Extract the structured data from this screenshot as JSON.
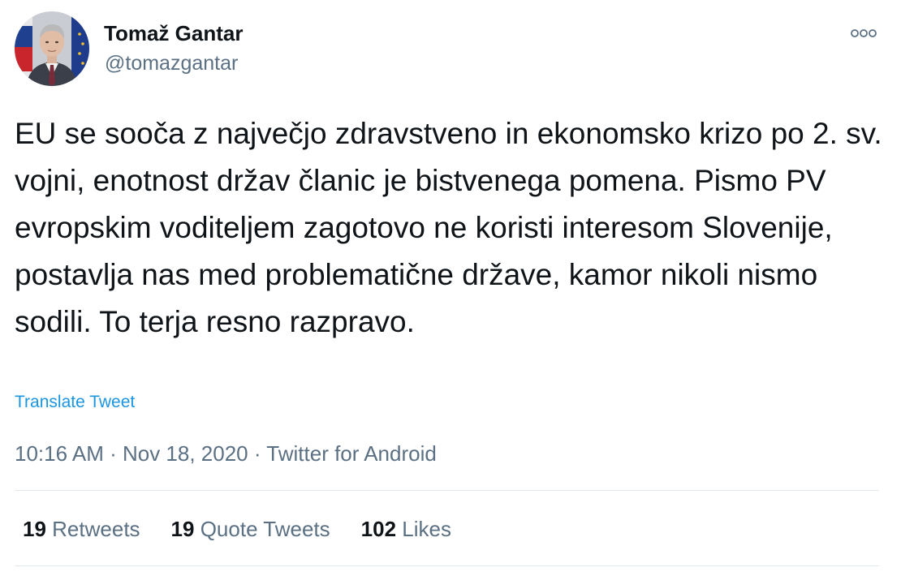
{
  "author": {
    "name": "Tomaž Gantar",
    "handle": "@tomazgantar"
  },
  "tweet": {
    "text": "EU se sooča z največjo zdravstveno in ekonomsko krizo po 2. sv. vojni, enotnost držav članic je bistvenega pomena. Pismo PV evropskim voditeljem zagotovo ne koristi interesom Slovenije, postavlja nas med problematične države, kamor nikoli nismo sodili. To terja resno razpravo.",
    "translate_label": "Translate Tweet"
  },
  "meta": {
    "time": "10:16 AM",
    "separator": " · ",
    "date": "Nov 18, 2020",
    "source": "Twitter for Android"
  },
  "stats": {
    "retweets": {
      "count": "19",
      "label": "Retweets"
    },
    "quote_tweets": {
      "count": "19",
      "label": "Quote Tweets"
    },
    "likes": {
      "count": "102",
      "label": "Likes"
    }
  },
  "icons": {
    "more": "more-options-icon",
    "avatar": "profile-avatar"
  },
  "colors": {
    "text": "#0f1419",
    "secondary": "#5b7083",
    "link": "#1b95e0",
    "divider": "#e1e8ed"
  }
}
